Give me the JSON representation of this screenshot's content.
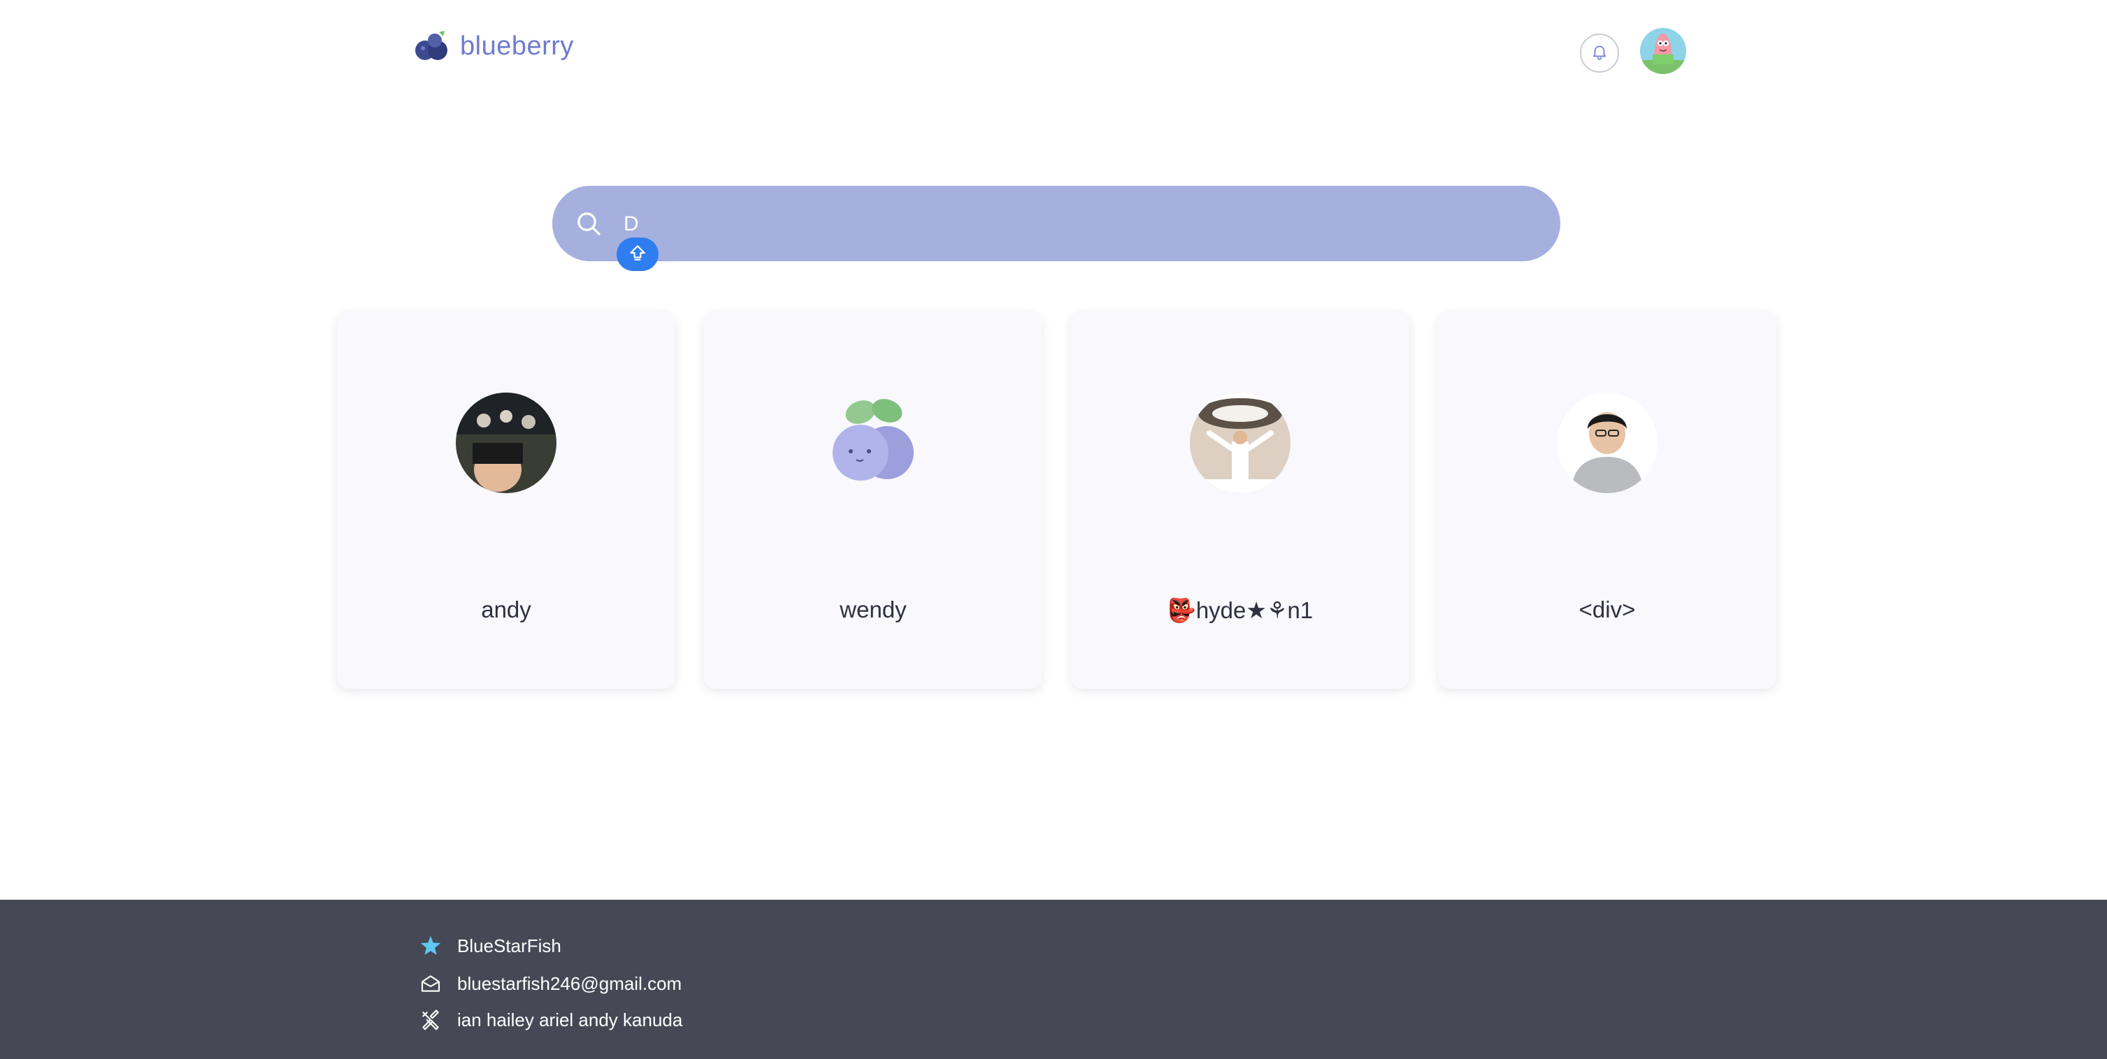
{
  "header": {
    "brand": "blueberry",
    "icons": {
      "logo": "blueberry-logo-icon",
      "notifications": "bell-icon",
      "profile": "patrick-star-avatar"
    }
  },
  "search": {
    "value": "D",
    "placeholder": "",
    "icon": "search-icon",
    "indicator_icon": "shift-key-icon"
  },
  "colors": {
    "brand": "#6f7bd0",
    "search_bg": "#a5b0df",
    "card_bg": "#f8f8fd",
    "footer_bg": "#464955",
    "indicator": "#2f7df0"
  },
  "results": [
    {
      "name": "andy",
      "avatar": "photo-avatar"
    },
    {
      "name": "wendy",
      "avatar": "blueberry-mascot-avatar"
    },
    {
      "name": "👺hyde★⚘n1",
      "avatar": "photo-avatar"
    },
    {
      "name": "<div>",
      "avatar": "photo-avatar"
    }
  ],
  "footer": {
    "team": "BlueStarFish",
    "email": "bluestarfish246@gmail.com",
    "members": "ian hailey ariel andy kanuda",
    "icons": [
      "starfish-icon",
      "mail-icon",
      "tools-icon"
    ]
  }
}
